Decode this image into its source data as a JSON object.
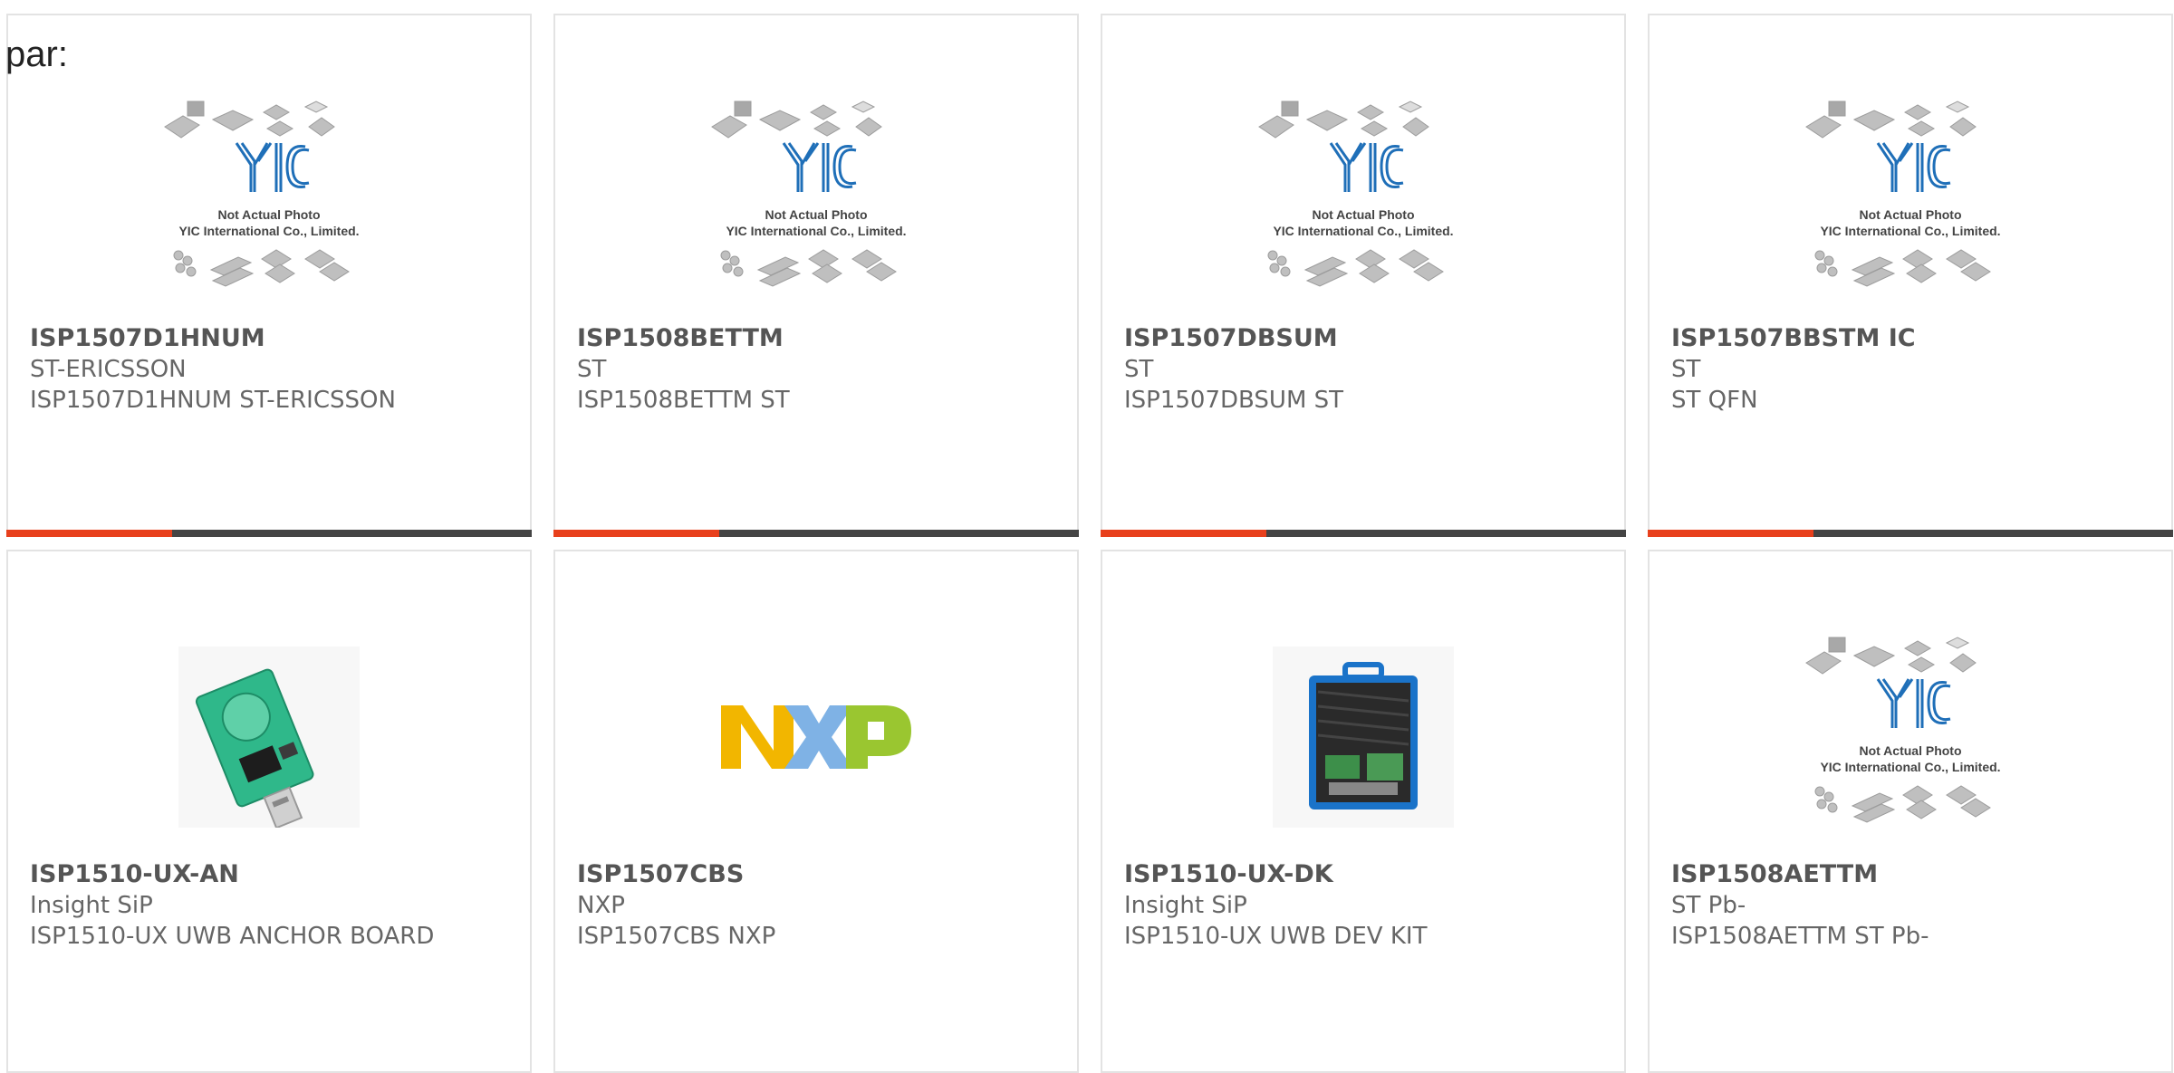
{
  "page": {
    "heading": "par:"
  },
  "colors": {
    "accent": "#e8401c",
    "bar": "#444444",
    "border": "#e3e3e3",
    "yic_blue": "#1f6fb8"
  },
  "placeholder": {
    "line1": "Not Actual Photo",
    "line2": "YIC International Co., Limited.",
    "logo": "YIC"
  },
  "products": [
    {
      "part_number": "ISP1507D1HNUM",
      "manufacturer": "ST-ERICSSON",
      "description": "ISP1507D1HNUM ST-ERICSSON",
      "image": "yic-placeholder"
    },
    {
      "part_number": "ISP1508BETTM",
      "manufacturer": "ST",
      "description": "ISP1508BETTM ST",
      "image": "yic-placeholder"
    },
    {
      "part_number": "ISP1507DBSUM",
      "manufacturer": "ST",
      "description": "ISP1507DBSUM ST",
      "image": "yic-placeholder"
    },
    {
      "part_number": "ISP1507BBSTM IC",
      "manufacturer": "ST",
      "description": "ST QFN",
      "image": "yic-placeholder"
    },
    {
      "part_number": "ISP1510-UX-AN",
      "manufacturer": "Insight SiP",
      "description": "ISP1510-UX UWB ANCHOR BOARD",
      "image": "usb-board"
    },
    {
      "part_number": "ISP1507CBS",
      "manufacturer": "NXP",
      "description": "ISP1507CBS NXP",
      "image": "nxp-logo"
    },
    {
      "part_number": "ISP1510-UX-DK",
      "manufacturer": "Insight SiP",
      "description": "ISP1510-UX UWB DEV KIT",
      "image": "dev-kit-case"
    },
    {
      "part_number": "ISP1508AETTM",
      "manufacturer": "ST Pb-",
      "description": "ISP1508AETTM ST Pb-",
      "image": "yic-placeholder"
    }
  ]
}
